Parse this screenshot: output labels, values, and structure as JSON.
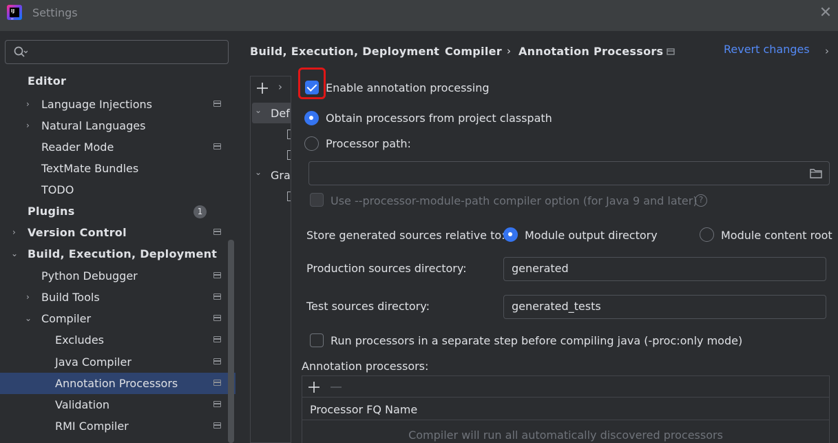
{
  "window": {
    "title": "Settings"
  },
  "search": {
    "placeholder": ""
  },
  "sidebar": {
    "items": [
      {
        "label": "Editor"
      },
      {
        "label": "Language Injections"
      },
      {
        "label": "Natural Languages"
      },
      {
        "label": "Reader Mode"
      },
      {
        "label": "TextMate Bundles"
      },
      {
        "label": "TODO"
      },
      {
        "label": "Plugins",
        "badge": "1"
      },
      {
        "label": "Version Control"
      },
      {
        "label": "Build, Execution, Deployment"
      },
      {
        "label": "Python Debugger"
      },
      {
        "label": "Build Tools"
      },
      {
        "label": "Compiler"
      },
      {
        "label": "Excludes"
      },
      {
        "label": "Java Compiler"
      },
      {
        "label": "Annotation Processors",
        "selected": true
      },
      {
        "label": "Validation"
      },
      {
        "label": "RMI Compiler"
      }
    ]
  },
  "breadcrumb": {
    "items": [
      "Build, Execution, Deployment",
      "Compiler",
      "Annotation Processors"
    ],
    "separator": "›",
    "revert_label": "Revert changes"
  },
  "modules": {
    "items": [
      {
        "label": "Def"
      },
      {
        "label": "Gra"
      }
    ]
  },
  "annotation": {
    "enable_label": "Enable annotation processing",
    "enable_checked": true,
    "obtain_label": "Obtain processors from project classpath",
    "processor_path_label": "Processor path:",
    "processor_path_value": "",
    "module_path_label": "Use --processor-module-path compiler option (for Java 9 and later)",
    "help_glyph": "?",
    "store_label": "Store generated sources relative to:",
    "module_output_label": "Module output directory",
    "module_content_label": "Module content root",
    "production_label": "Production sources directory:",
    "production_value": "generated",
    "test_label": "Test sources directory:",
    "test_value": "generated_tests",
    "separate_step_label": "Run processors in a separate step before compiling java (-proc:only mode)",
    "processors_label": "Annotation processors:",
    "table_header": "Processor FQ Name",
    "table_empty": "Compiler will run all automatically discovered processors"
  },
  "colors": {
    "accent": "#3574f0",
    "link": "#548af7",
    "selection": "#2e436e",
    "highlight_box": "#e01717"
  }
}
